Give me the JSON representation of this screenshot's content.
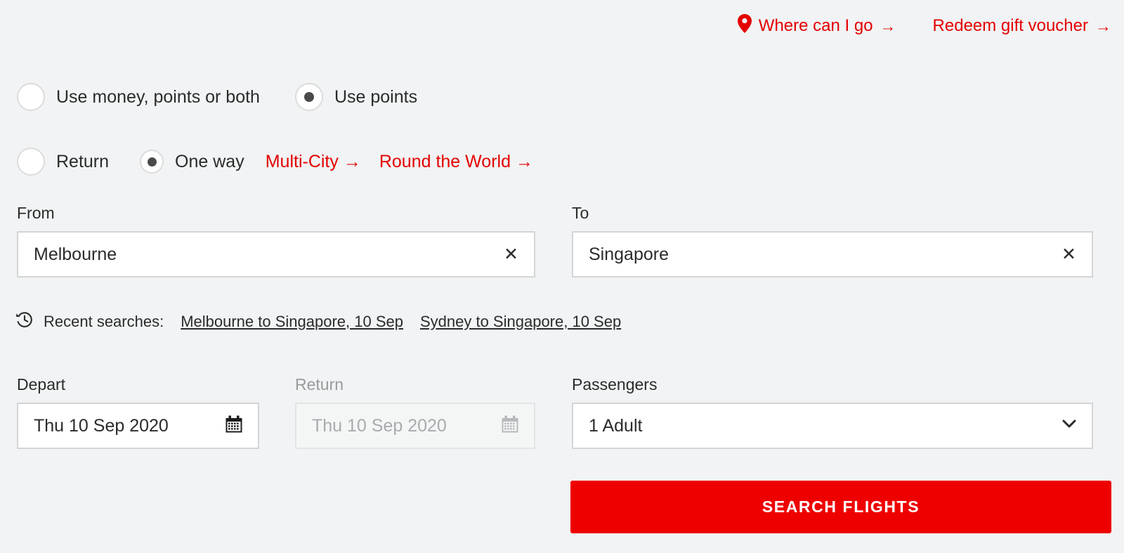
{
  "top_links": [
    {
      "label": "Where can I go",
      "arrow": "→",
      "icon": "location-pin-icon"
    },
    {
      "label": "Redeem gift voucher",
      "arrow": "→",
      "icon": null
    }
  ],
  "fare_options": [
    {
      "label": "Use money, points or both",
      "selected": false
    },
    {
      "label": "Use points",
      "selected": true
    }
  ],
  "trip_options": [
    {
      "label": "Return",
      "selected": false
    },
    {
      "label": "One way",
      "selected": true
    }
  ],
  "trip_links": [
    {
      "label": "Multi-City",
      "arrow": "→"
    },
    {
      "label": "Round the World",
      "arrow": "→"
    }
  ],
  "from_field": {
    "label": "From",
    "value": "Melbourne",
    "placeholder": "From",
    "clear_icon": "✕"
  },
  "to_field": {
    "label": "To",
    "value": "Singapore",
    "placeholder": "To",
    "clear_icon": "✕"
  },
  "recent": {
    "icon": "history-icon",
    "label": "Recent searches:",
    "items": [
      "Melbourne to Singapore, 10 Sep",
      "Sydney to Singapore, 10 Sep"
    ]
  },
  "depart_field": {
    "label": "Depart",
    "value": "Thu 10 Sep 2020",
    "placeholder": "Thu 10 Sep 2020",
    "icon": "calendar-icon",
    "disabled": false
  },
  "return_field": {
    "label": "Return",
    "value": "Thu 10 Sep 2020",
    "placeholder": "Thu 10 Sep 2020",
    "icon": "calendar-icon",
    "disabled": true
  },
  "passengers_field": {
    "label": "Passengers",
    "value": "1 Adult",
    "options": [
      "1 Adult"
    ],
    "icon": "chevron-down-icon"
  },
  "search_button": {
    "label": "SEARCH FLIGHTS"
  },
  "colors": {
    "brand_red": "#e40000",
    "button_red": "#ee0000",
    "page_background": "#f1f3f4",
    "field_border": "#d3d5d6",
    "text": "#2b2b2b",
    "muted_text": "#a8abad"
  }
}
